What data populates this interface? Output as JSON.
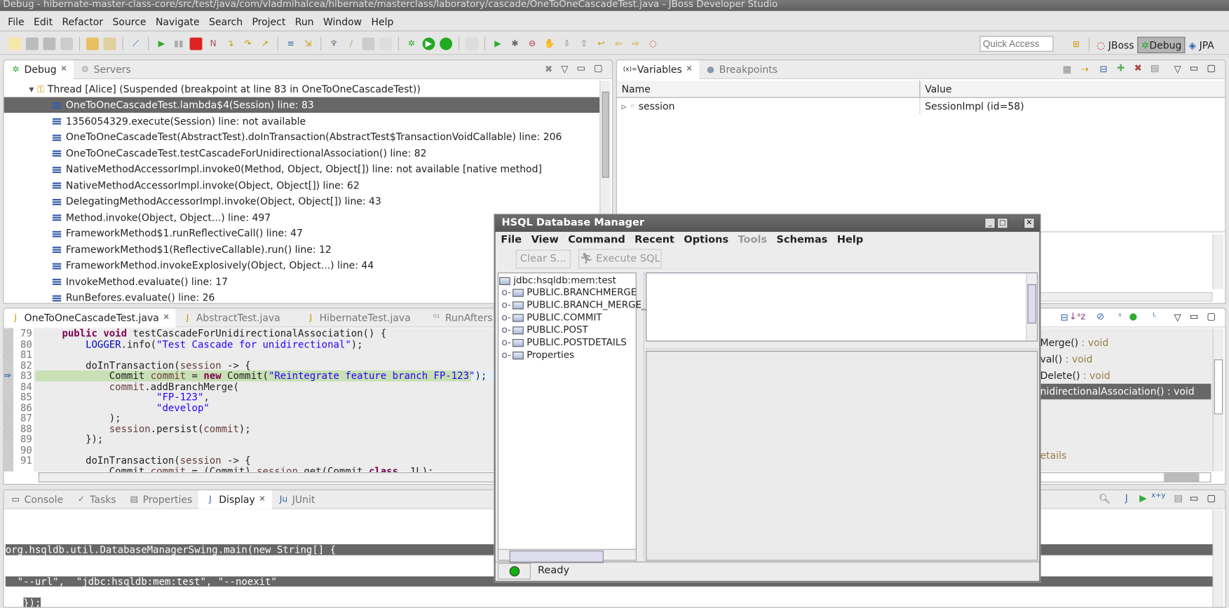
{
  "window_title": "Debug - hibernate-master-class-core/src/test/java/com/vladmihalcea/hibernate/masterclass/laboratory/cascade/OneToOneCascadeTest.java - JBoss Developer Studio",
  "menu": [
    "File",
    "Edit",
    "Refactor",
    "Source",
    "Navigate",
    "Search",
    "Project",
    "Run",
    "Window",
    "Help"
  ],
  "quick_access_placeholder": "Quick Access",
  "perspectives": [
    "JBoss",
    "Debug",
    "JPA"
  ],
  "debug_view": {
    "tabs": [
      "Debug",
      "Servers"
    ],
    "thread": "Thread [Alice] (Suspended (breakpoint at line 83 in OneToOneCascadeTest))",
    "frames": [
      "OneToOneCascadeTest.lambda$4(Session) line: 83",
      "1356054329.execute(Session) line: not available",
      "OneToOneCascadeTest(AbstractTest).doInTransaction(AbstractTest$TransactionVoidCallable) line: 206",
      "OneToOneCascadeTest.testCascadeForUnidirectionalAssociation() line: 82",
      "NativeMethodAccessorImpl.invoke0(Method, Object, Object[]) line: not available [native method]",
      "NativeMethodAccessorImpl.invoke(Object, Object[]) line: 62",
      "DelegatingMethodAccessorImpl.invoke(Object, Object[]) line: 43",
      "Method.invoke(Object, Object...) line: 497",
      "FrameworkMethod$1.runReflectiveCall() line: 47",
      "FrameworkMethod$1(ReflectiveCallable).run() line: 12",
      "FrameworkMethod.invokeExplosively(Object, Object...) line: 44",
      "InvokeMethod.evaluate() line: 17",
      "RunBefores.evaluate() line: 26"
    ]
  },
  "variables_view": {
    "tabs": [
      "Variables",
      "Breakpoints"
    ],
    "columns": [
      "Name",
      "Value"
    ],
    "rows": [
      {
        "name": "session",
        "value": "SessionImpl  (id=58)"
      }
    ]
  },
  "editor": {
    "tabs": [
      "OneToOneCascadeTest.java",
      "AbstractTest.java",
      "HibernateTest.java",
      "RunAfters.class"
    ],
    "line_numbers": [
      "79",
      "80",
      "81",
      "82",
      "83",
      "84",
      "85",
      "86",
      "87",
      "88",
      "89",
      "90",
      "91"
    ],
    "current_line": "83"
  },
  "outline": {
    "items": [
      {
        "name": "Merge()",
        "type": " : void"
      },
      {
        "name": "val()",
        "type": " : void"
      },
      {
        "name": "Delete()",
        "type": " : void"
      },
      {
        "name": "nidirectionalAssociation()",
        "type": " : void"
      }
    ],
    "extra": "etails"
  },
  "bottom": {
    "tabs": [
      "Console",
      "Tasks",
      "Properties",
      "Display",
      "JUnit"
    ],
    "display_lines": [
      "org.hsqldb.util.DatabaseManagerSwing.main(new String[] {",
      "  \"--url\",  \"jdbc:hsqldb:mem:test\", \"--noexit\"",
      "});"
    ]
  },
  "hsql": {
    "title": "HSQL Database Manager",
    "menu": [
      "File",
      "View",
      "Command",
      "Recent",
      "Options",
      "Tools",
      "Schemas",
      "Help"
    ],
    "clear_button": "Clear S...",
    "execute_button": "Execute SQL",
    "tree_root": "jdbc:hsqldb:mem:test",
    "tree_items": [
      "PUBLIC.BRANCHMERGE",
      "PUBLIC.BRANCH_MERGE_C",
      "PUBLIC.COMMIT",
      "PUBLIC.POST",
      "PUBLIC.POSTDETAILS",
      "Properties"
    ],
    "status": "Ready",
    "status_color": "#12b012"
  }
}
